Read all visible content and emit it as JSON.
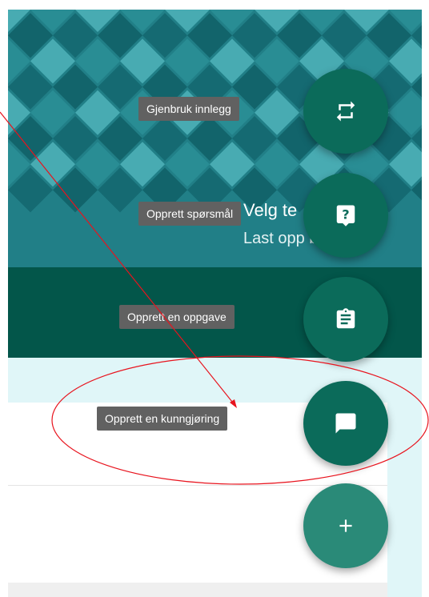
{
  "banner": {
    "title": "Velg te",
    "subtitle": "Last opp bilde"
  },
  "speed_dial": {
    "items": [
      {
        "label": "Gjenbruk innlegg",
        "icon": "repeat-icon"
      },
      {
        "label": "Opprett spørsmål",
        "icon": "question-icon"
      },
      {
        "label": "Opprett en oppgave",
        "icon": "assignment-icon"
      },
      {
        "label": "Opprett en kunngjøring",
        "icon": "announcement-icon"
      }
    ],
    "main_icon": "add-icon"
  },
  "colors": {
    "banner": "#1f7f86",
    "dark_band": "#03564a",
    "fab": "#0b6b5a",
    "fab_main": "#2a8a78",
    "tooltip": "#616161",
    "annotation": "#e8141e"
  }
}
